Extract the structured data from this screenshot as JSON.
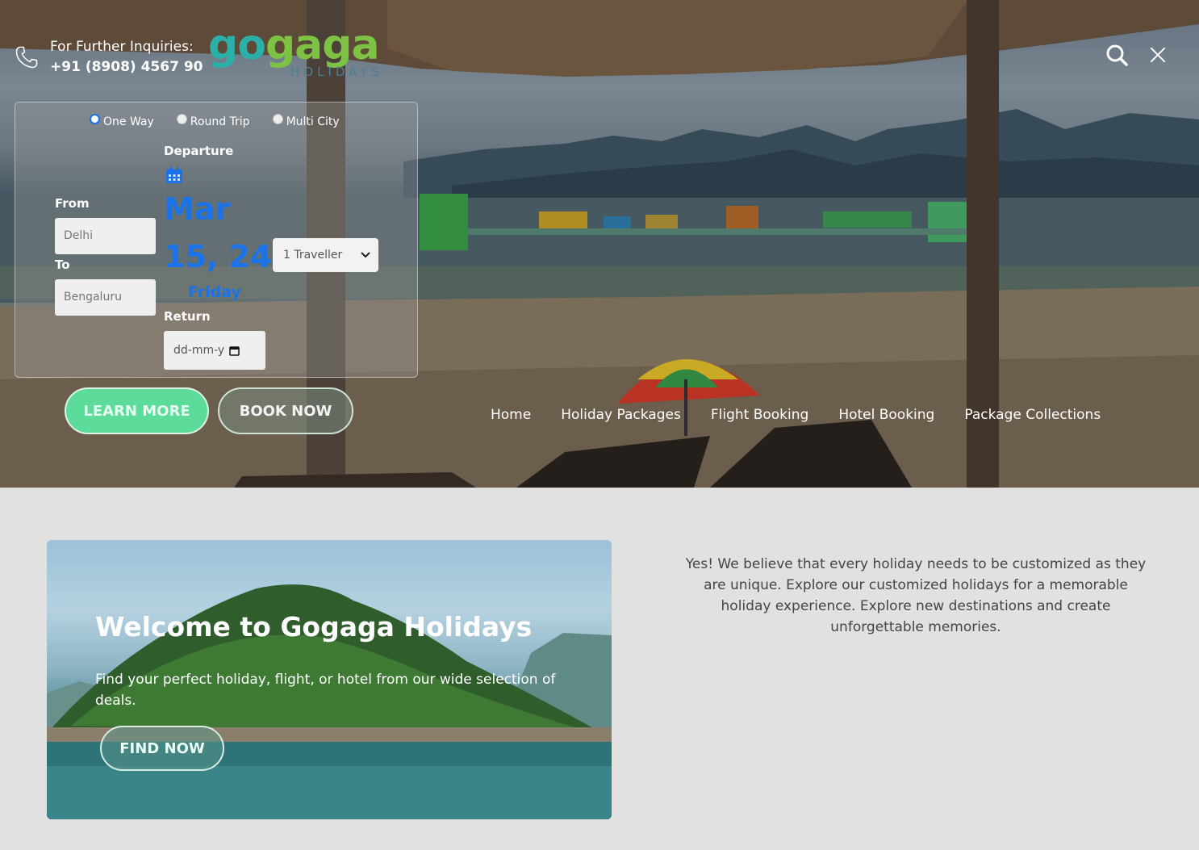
{
  "contact": {
    "line1": "For Further Inquiries:",
    "line2": "+91 (8908) 4567 90"
  },
  "logo": {
    "part1": "go",
    "part2": "gaga",
    "subtitle": "HOLIDAYS"
  },
  "booking": {
    "trip_types": [
      "One Way",
      "Round Trip",
      "Multi City"
    ],
    "selected_trip": "One Way",
    "from_label": "From",
    "from_value": "Delhi",
    "to_label": "To",
    "to_value": "Bengaluru",
    "departure_label": "Departure",
    "departure_month": "Mar",
    "departure_date": "15, 24",
    "departure_day": "Friday",
    "return_label": "Return",
    "return_placeholder": "dd-mm-y",
    "travellers": "1 Traveller"
  },
  "hero_buttons": {
    "learn_more": "LEARN MORE",
    "book_now": "BOOK NOW"
  },
  "nav": [
    "Home",
    "Holiday Packages",
    "Flight Booking",
    "Hotel Booking",
    "Package Collections"
  ],
  "card": {
    "title": "Welcome to Gogaga Holidays",
    "subtitle": "Find your perfect holiday, flight, or hotel from our wide selection of deals.",
    "button": "FIND NOW"
  },
  "blurb": "Yes! We believe that every holiday needs to be customized as they are unique. Explore our customized holidays for a memorable holiday experience. Explore new destinations and create unforgettable memories.",
  "colors": {
    "accent_blue": "#1a73e8",
    "logo_teal": "#2ab0a8",
    "logo_green": "#7dc242",
    "learn_more_green": "#5ddb9a"
  }
}
